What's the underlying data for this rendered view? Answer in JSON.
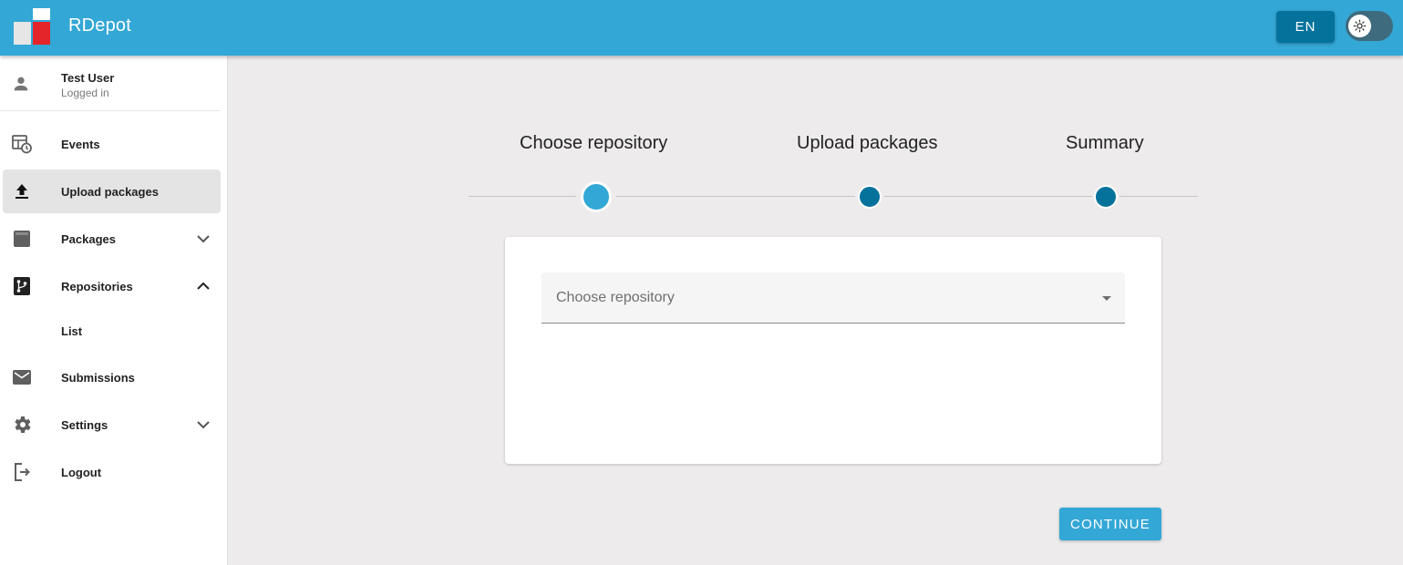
{
  "app": {
    "title": "RDepot"
  },
  "header": {
    "language": "EN"
  },
  "user": {
    "name": "Test User",
    "status": "Logged in"
  },
  "sidebar": {
    "items": [
      {
        "label": "Events",
        "icon": "events-icon"
      },
      {
        "label": "Upload packages",
        "icon": "upload-icon",
        "active": true
      },
      {
        "label": "Packages",
        "icon": "package-icon",
        "chevron": "down"
      },
      {
        "label": "Repositories",
        "icon": "repository-icon",
        "chevron": "up"
      },
      {
        "label": "List",
        "sub": true
      },
      {
        "label": "Submissions",
        "icon": "mail-icon"
      },
      {
        "label": "Settings",
        "icon": "gear-icon",
        "chevron": "down"
      },
      {
        "label": "Logout",
        "icon": "logout-icon"
      }
    ]
  },
  "stepper": {
    "steps": [
      {
        "label": "Choose repository",
        "active": true
      },
      {
        "label": "Upload packages",
        "active": false
      },
      {
        "label": "Summary",
        "active": false
      }
    ]
  },
  "form": {
    "repository_placeholder": "Choose repository"
  },
  "actions": {
    "continue_label": "CONTINUE"
  },
  "colors": {
    "primary": "#33a7d5",
    "primary_dark": "#05729c",
    "background": "#edebeb",
    "logo_blue": "#33a7d5",
    "logo_red": "#e4252a"
  }
}
